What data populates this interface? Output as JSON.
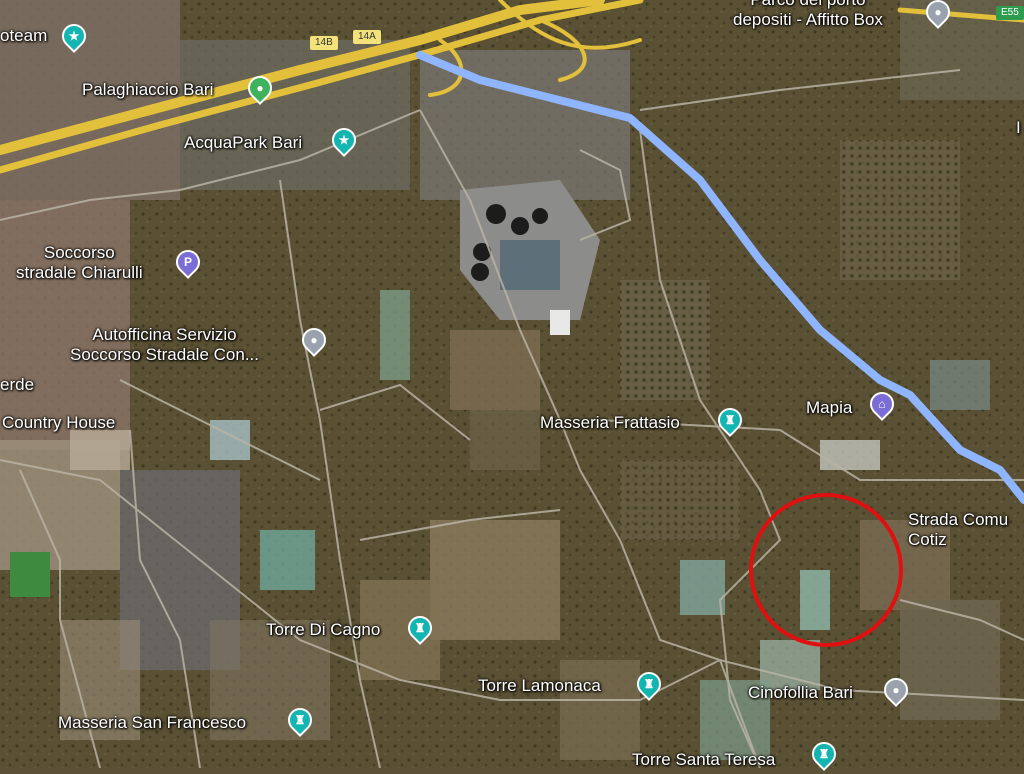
{
  "colors": {
    "route": "#8fb5ff",
    "highway": "#e2c03b",
    "teal_marker": "#12b5b0",
    "green_marker": "#3fb35b",
    "purple_marker": "#7b6cd6",
    "gray_marker": "#9aa3ad",
    "highlight_circle": "#e01010",
    "label_text": "#ffffff"
  },
  "shields": {
    "a": "14B",
    "b": "14A",
    "c": "E55"
  },
  "places": [
    {
      "label": "oteam",
      "icon": "teal-pin-icon"
    },
    {
      "label": "Palaghiaccio Bari",
      "icon": "green-pin-icon"
    },
    {
      "label": "AcquaPark Bari",
      "icon": "teal-pin-icon"
    },
    {
      "label": "Soccorso\nstradale Chiarulli",
      "icon": "parking-icon"
    },
    {
      "label": "Autofficina Servizio\nSoccorso Stradale Con...",
      "icon": "gray-pin-icon"
    },
    {
      "label": "erde",
      "icon": ""
    },
    {
      "label": "Country House",
      "icon": ""
    },
    {
      "label": "Masseria Frattasio",
      "icon": "landmark-icon"
    },
    {
      "label": "Mapia",
      "icon": "shopping-icon"
    },
    {
      "label": "Parco del porto\ndepositi - Affitto Box",
      "icon": "gray-pin-icon"
    },
    {
      "label": "Strada Comu\nCotiz",
      "icon": ""
    },
    {
      "label": "Torre Di Cagno",
      "icon": "landmark-icon"
    },
    {
      "label": "Torre Lamonaca",
      "icon": "landmark-icon"
    },
    {
      "label": "Cinofollia Bari",
      "icon": "gray-pin-icon"
    },
    {
      "label": "Masseria San Francesco",
      "icon": "landmark-icon"
    },
    {
      "label": "Torre Santa Teresa",
      "icon": "landmark-icon"
    },
    {
      "label": "I",
      "icon": ""
    }
  ]
}
